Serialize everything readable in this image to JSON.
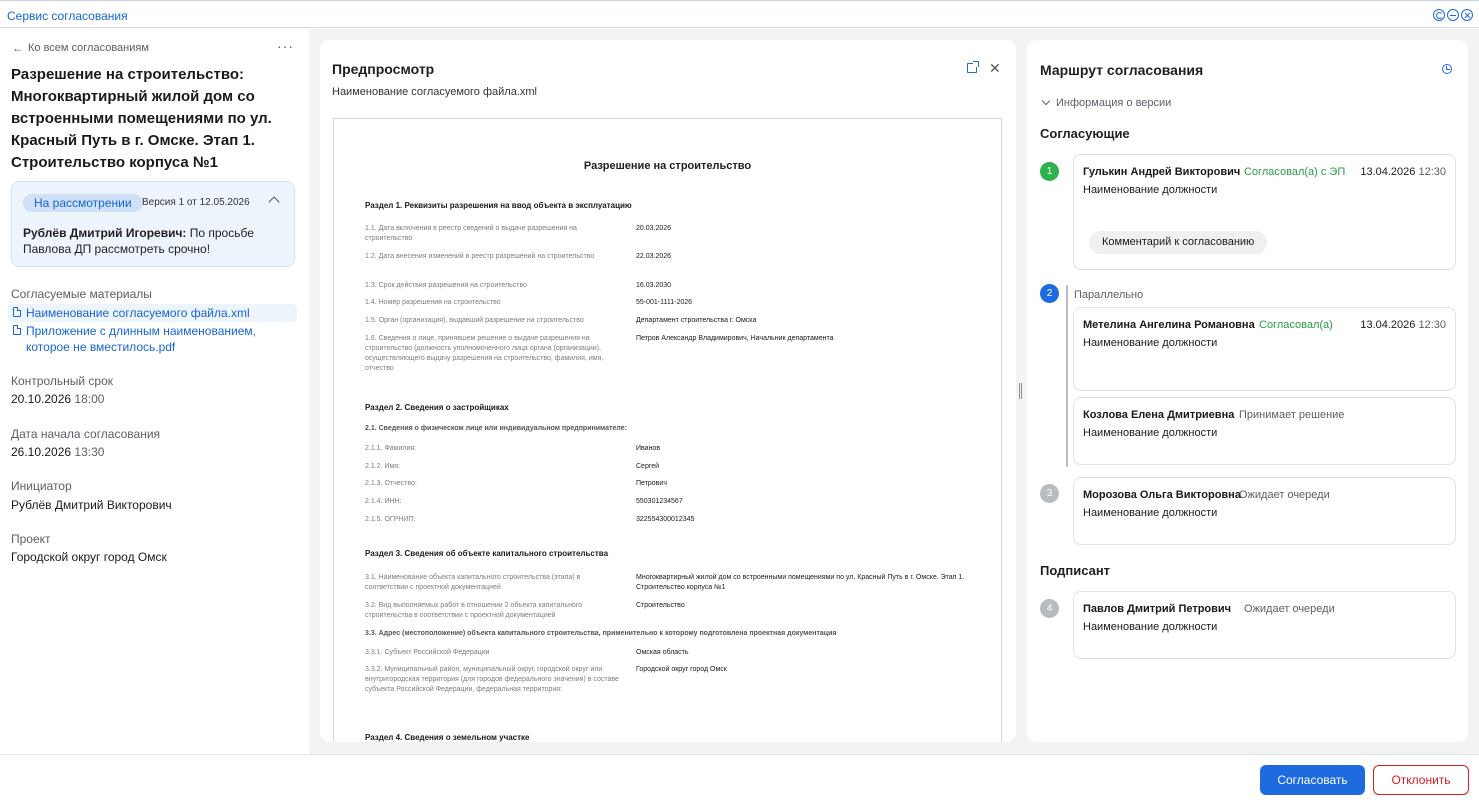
{
  "window": {
    "title": "Сервис согласования"
  },
  "left": {
    "back_label": "Ко всем согласованиям",
    "more": "···",
    "title": "Разрешение на строительство: Многоквартирный жилой дом со встроенными помещениями по ул. Красный Путь в г. Омске. Этап 1. Строительство корпуса №1",
    "status": {
      "badge": "На рассмотрении",
      "version": "Версия 1 от 12.05.2026",
      "comment_author": "Рублёв Дмитрий Игоревич:",
      "comment_text": " По просьбе Павлова ДП рассмотреть срочно!"
    },
    "materials_label": "Согласуемые материалы",
    "files": [
      "Наименование согласуемого файла.xml",
      "Приложение с длинным наименованием, которое не вместилось.pdf"
    ],
    "deadline_label": "Контрольный срок",
    "deadline_date": "20.10.2026",
    "deadline_time": " 18:00",
    "start_label": "Дата начала согласования",
    "start_date": "26.10.2026",
    "start_time": " 13:30",
    "initiator_label": "Инициатор",
    "initiator": "Рублёв Дмитрий Викторович",
    "project_label": "Проект",
    "project": "Городской округ город Омск"
  },
  "preview": {
    "title": "Предпросмотр",
    "filename": "Наименование согласуемого файла.xml",
    "close": "✕",
    "doc": {
      "title": "Разрешение на строительство",
      "section1": "Раздел 1. Реквизиты разрешения на ввод объекта в эксплуатацию",
      "rows1": [
        {
          "label": "1.1. Дата включения в реестр сведений о выдаче разрешения на строительство",
          "value": "20.03.2026"
        },
        {
          "label": "1.2. Дата внесения изменений в реестр разрешений на строительство",
          "value": "22.03.2026"
        },
        {
          "label": "1.3. Срок действия разрешения на строительство",
          "value": "16.03.2030"
        },
        {
          "label": "1.4. Номер разрешения на строительство",
          "value": "55-001-1111-2026"
        },
        {
          "label": "1.5. Орган (организация), выдавший разрешение на строительство",
          "value": "Департамент строительства г. Омска"
        },
        {
          "label": "1.6. Сведения о лице, принявшем решение о выдаче разрешения на строительство (должность уполномоченного лица органа (организации), осуществляющего выдачу разрешения на строительство, фамилия, имя, отчество",
          "value": "Петров Александр Владимирович, Начальник департамента"
        }
      ],
      "section2": "Раздел 2. Сведения о застройщиках",
      "subsection2": "2.1. Сведения о физическом лице или индивидуальном предпринимателе:",
      "rows2": [
        {
          "label": "2.1.1. Фамилия:",
          "value": "Иванов"
        },
        {
          "label": "2.1.2. Имя:",
          "value": "Сергей"
        },
        {
          "label": "2.1.3. Отчество:",
          "value": "Петрович"
        },
        {
          "label": "2.1.4. ИНН:",
          "value": "550301234567"
        },
        {
          "label": "2.1.5. ОГРНИП:",
          "value": "322554300012345"
        }
      ],
      "section3": "Раздел 3. Сведения об объекте капитального строительства",
      "rows3": [
        {
          "label": "3.1. Наименование объекта капитального строительства (этапа) в соответствии с проектной документацией",
          "value": "Многоквартирный жилой дом со встроенными помещениями по ул. Красный Путь в г. Омске. Этап 1. Строительство корпуса №1"
        },
        {
          "label": "3.2. Вид выполняемых работ в отношении 2 объекта капитального строительства в соответствии с проектной документацией",
          "value": "Строительство"
        }
      ],
      "subsection3": "3.3. Адрес (местоположение) объекта капитального строительства, применительно к которому подготовлена проектная документация",
      "rows33": [
        {
          "label": "3.3.1. Субъект Российской Федерации",
          "value": "Омская область"
        },
        {
          "label": "3.3.2. Муниципальный район, муниципальный округ, городской округ или внутригородская территория (для городов федерального значения) в составе субъекта Российской Федерации, федеральная территория:",
          "value": "Городской округ город Омск"
        }
      ],
      "section4": "Раздел 4. Сведения о земельном участке"
    }
  },
  "route": {
    "title": "Маршрут согласования",
    "version_info": "Информация о версии",
    "approvers_title": "Согласующие",
    "signer_title": "Подписант",
    "parallel_label": "Параллельно",
    "steps": [
      {
        "num": "1",
        "name": "Гулькин Андрей Викторович",
        "state": "Согласовал(а) с ЭП",
        "date": "13.04.2026",
        "time": " 12:30",
        "position": "Наименование должности",
        "comment": "Комментарий к согласованию"
      },
      {
        "num": "2",
        "name": "Метелина Ангелина Романовна",
        "state": "Согласовал(а)",
        "date": "13.04.2026",
        "time": " 12:30",
        "position": "Наименование должности"
      },
      {
        "name": "Козлова Елена Дмитриевна",
        "state": "Принимает решение",
        "position": "Наименование должности"
      },
      {
        "num": "3",
        "name": "Морозова Ольга Викторовна",
        "state": "Ожидает очереди",
        "position": "Наименование должности"
      },
      {
        "num": "4",
        "name": "Павлов Дмитрий Петрович",
        "state": "Ожидает очереди",
        "position": "Наименование должности"
      }
    ]
  },
  "footer": {
    "approve": "Согласовать",
    "reject": "Отклонить"
  }
}
